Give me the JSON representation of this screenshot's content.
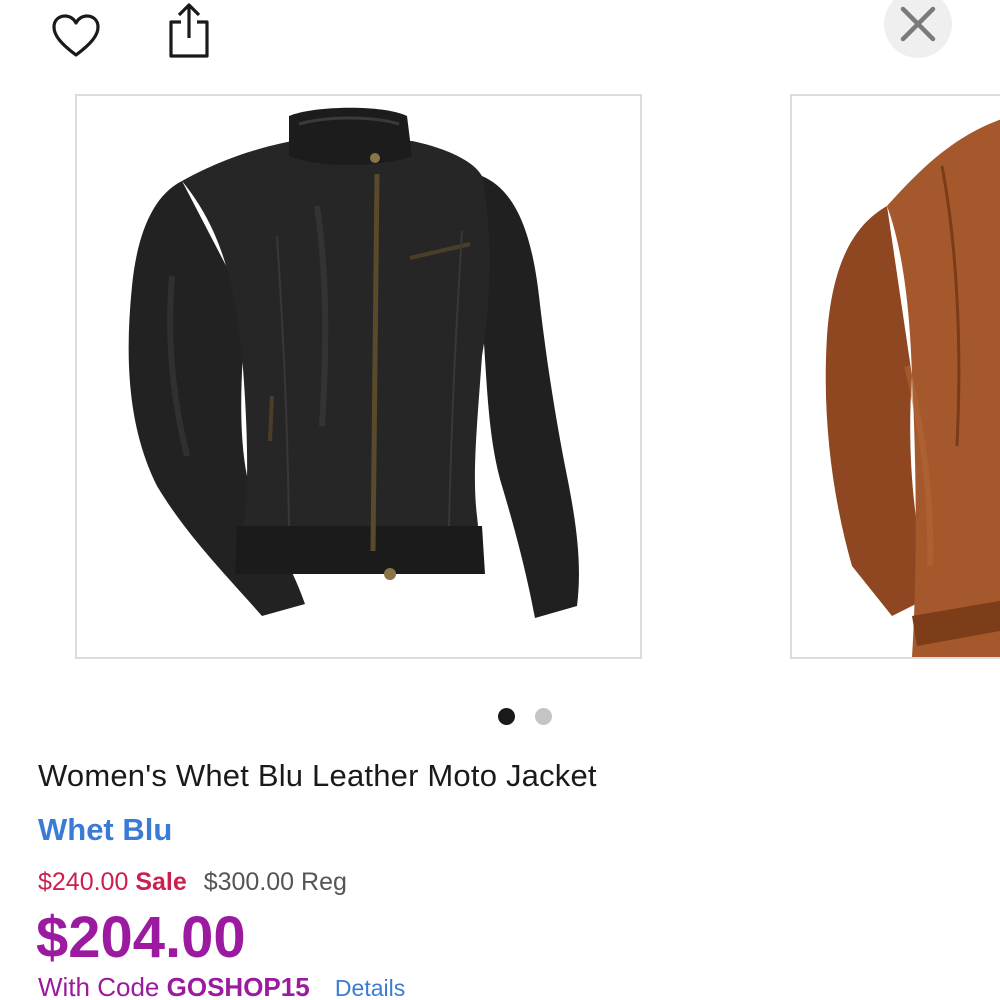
{
  "header": {
    "favorite_icon": "heart-icon",
    "share_icon": "share-icon",
    "close_icon": "close-icon"
  },
  "carousel": {
    "slides": [
      {
        "alt": "black-leather-jacket-front",
        "jacket_color": "#1e1e1e"
      },
      {
        "alt": "brown-leather-jacket-front",
        "jacket_color": "#9a4f25"
      }
    ],
    "active_index": 0,
    "dot_count": 2
  },
  "product": {
    "title": "Women's Whet Blu Leather Moto Jacket",
    "brand": "Whet Blu",
    "sale_price": "$240.00",
    "sale_label": "Sale",
    "reg_price": "$300.00 Reg",
    "promo_price": "$204.00",
    "promo_prefix": "With Code",
    "promo_code": "GOSHOP15",
    "details_link": "Details"
  },
  "colors": {
    "sale": "#cc1f4f",
    "promo": "#9b1aa0",
    "link": "#3a7bd5"
  }
}
